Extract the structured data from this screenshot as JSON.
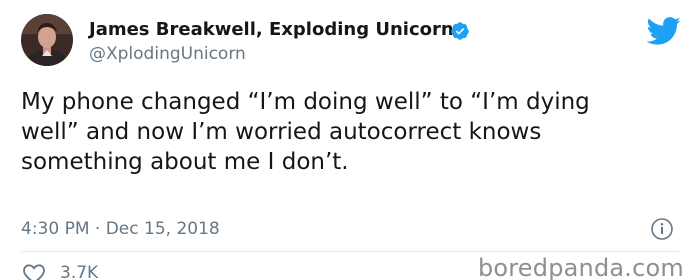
{
  "author": {
    "name": "James Breakwell, Exploding Unicorn",
    "handle": "@XplodingUnicorn",
    "verified": true
  },
  "tweet": {
    "text": "My phone changed “I’m doing well” to “I’m dying\nwell” and now I’m worried autocorrect knows\nsomething about me I don’t.",
    "timestamp": "4:30 PM · Dec 15, 2018",
    "like_count": "3.7K"
  },
  "watermark": "boredpanda.com",
  "icons": {
    "platform": "twitter-bird-icon",
    "info": "info-icon",
    "like": "heart-outline-icon",
    "verified": "verified-badge-icon"
  },
  "colors": {
    "brand_blue": "#1da1f2",
    "text_primary": "#14171a",
    "text_secondary": "#657786",
    "divider": "#e1e8ed"
  }
}
